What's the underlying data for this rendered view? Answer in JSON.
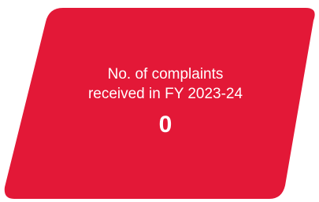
{
  "card": {
    "label_line1": "No. of complaints",
    "label_line2": "received in FY 2023-24",
    "value": "0",
    "background_color": "#E31837",
    "text_color": "#FFFFFF"
  }
}
